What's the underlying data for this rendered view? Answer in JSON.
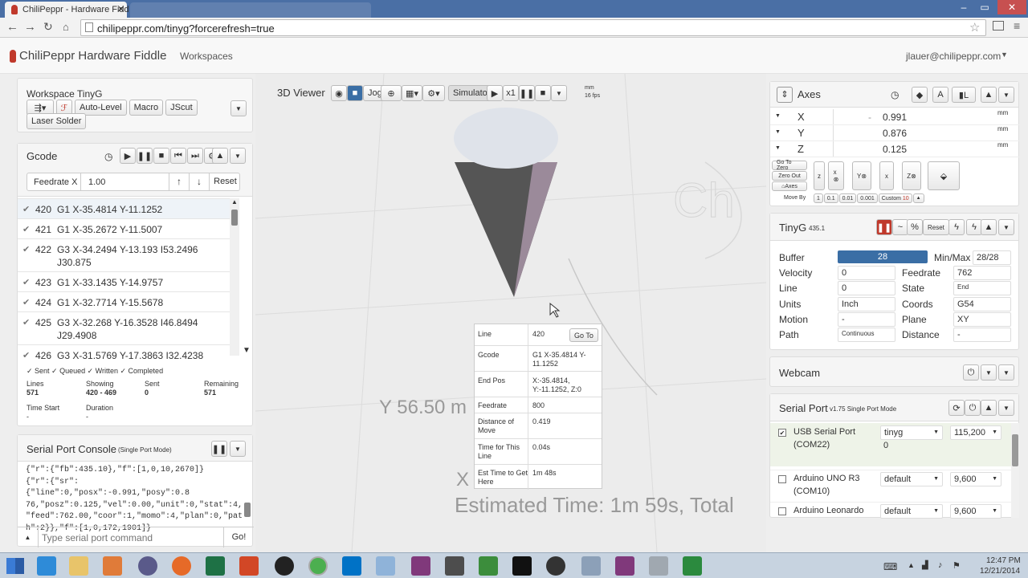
{
  "browser": {
    "active_tab": "ChiliPeppr - Hardware Fidd",
    "url": "chilipeppr.com/tinyg?forcerefresh=true"
  },
  "app": {
    "brand": "ChiliPeppr Hardware Fiddle",
    "nav_workspaces": "Workspaces",
    "user_email": "jlauer@chilipeppr.com"
  },
  "workspace": {
    "title": "Workspace TinyG",
    "buttons": [
      "Auto-Level",
      "Macro",
      "JScut",
      "Laser Solder"
    ]
  },
  "gcode": {
    "title": "Gcode",
    "feedrate_label": "Feedrate X",
    "feedrate_value": "1.00",
    "reset": "Reset",
    "lines": [
      {
        "num": "420",
        "code": "G1 X-35.4814 Y-11.1252",
        "code2": ""
      },
      {
        "num": "421",
        "code": "G1 X-35.2672 Y-11.5007",
        "code2": ""
      },
      {
        "num": "422",
        "code": "G3 X-34.2494 Y-13.193 I53.2496",
        "code2": "J30.875"
      },
      {
        "num": "423",
        "code": "G1 X-33.1435 Y-14.9757",
        "code2": ""
      },
      {
        "num": "424",
        "code": "G1 X-32.7714 Y-15.5678",
        "code2": ""
      },
      {
        "num": "425",
        "code": "G3 X-32.268 Y-16.3528 I46.8494",
        "code2": "J29.4908"
      },
      {
        "num": "426",
        "code": "G3 X-31.5769 Y-17.3863 I32.4238",
        "code2": ""
      }
    ],
    "legend": "✓ Sent ✓ Queued ✓ Written ✓ Completed",
    "stats": {
      "lines_label": "Lines",
      "lines": "571",
      "showing_label": "Showing",
      "showing": "420 - 469",
      "sent_label": "Sent",
      "sent": "0",
      "remaining_label": "Remaining",
      "remaining": "571",
      "time_start_label": "Time Start",
      "time_start": "-",
      "duration_label": "Duration",
      "duration": "-"
    }
  },
  "console": {
    "title": "Serial Port Console",
    "subtitle": "(Single Port Mode)",
    "lines": [
      "{\"r\":{\"fb\":435.10},\"f\":[1,0,10,2670]}",
      "{\"r\":{\"sr\":{\"line\":0,\"posx\":-0.991,\"posy\":0.8",
      "76,\"posz\":0.125,\"vel\":0.00,\"unit\":0,\"stat\":4,",
      "\"feed\":762.00,\"coor\":1,\"momo\":4,\"plan\":0,\"pat",
      "h\":2}},\"f\":[1,0,172,1901]}"
    ],
    "input_placeholder": "Type serial port command",
    "go": "Go!"
  },
  "viewer": {
    "title": "3D Viewer",
    "jog": "Jog",
    "simulator": "Simulator",
    "speed": "x1",
    "unit": "mm",
    "fps": "16 fps",
    "overlay_y": "Y 56.50 m",
    "overlay_x": "X",
    "overlay_est": "Estimated Time: 1m 59s, Total"
  },
  "tooltip": {
    "rows": [
      {
        "k": "Line",
        "v": "420"
      },
      {
        "k": "Gcode",
        "v": "G1 X-35.4814 Y-11.1252"
      },
      {
        "k": "End Pos",
        "v": "X:-35.4814, Y:-11.1252, Z:0"
      },
      {
        "k": "Feedrate",
        "v": "800"
      },
      {
        "k": "Distance of Move",
        "v": "0.419"
      },
      {
        "k": "Time for This Line",
        "v": "0.04s"
      },
      {
        "k": "Est Time to Get Here",
        "v": "1m 48s"
      }
    ],
    "goto": "Go To"
  },
  "axes": {
    "title": "Axes",
    "rows": [
      {
        "axis": "X",
        "value": "0.991",
        "unit": "mm"
      },
      {
        "axis": "Y",
        "value": "0.876",
        "unit": "mm"
      },
      {
        "axis": "Z",
        "value": "0.125",
        "unit": "mm"
      }
    ],
    "goto_zero": "Go To Zero",
    "zero_out": "Zero Out",
    "axes_btn": "Axes",
    "move_by": "Move By",
    "move_values": [
      "1",
      "0.1",
      "0.01",
      "0.001",
      "Custom",
      "10"
    ]
  },
  "tinyg": {
    "title": "TinyG",
    "version": "435.1",
    "reset": "Reset",
    "buffer_label": "Buffer",
    "buffer": "28",
    "buffer_fraction": 1.0,
    "minmax_label": "Min/Max",
    "minmax": "28/28",
    "velocity_label": "Velocity",
    "velocity": "0",
    "feedrate_label": "Feedrate",
    "feedrate": "762",
    "line_label": "Line",
    "line": "0",
    "state_label": "State",
    "state": "End",
    "units_label": "Units",
    "units": "Inch",
    "coords_label": "Coords",
    "coords": "G54",
    "motion_label": "Motion",
    "motion": "-",
    "plane_label": "Plane",
    "plane": "XY",
    "path_label": "Path",
    "path": "Continuous",
    "distance_label": "Distance",
    "distance": "-"
  },
  "webcam": {
    "title": "Webcam"
  },
  "serial": {
    "title": "Serial Port",
    "subtitle": "v1.75 Single Port Mode",
    "ports": [
      {
        "name": "USB Serial Port",
        "com": "(COM22)",
        "type": "tinyg",
        "baud": "115,200",
        "count": "0",
        "checked": true
      },
      {
        "name": "Arduino UNO R3",
        "com": "(COM10)",
        "type": "default",
        "baud": "9,600",
        "checked": false
      },
      {
        "name": "Arduino Leonardo",
        "com": "",
        "type": "default",
        "baud": "9,600",
        "checked": false
      }
    ]
  },
  "taskbar": {
    "time": "12:47 PM",
    "date": "12/21/2014"
  },
  "colors": {
    "brand_red": "#c0392b",
    "buffer_blue": "#3a6ea5",
    "highlight": "#eef3f8",
    "taskbar": "#c7d3e0"
  }
}
